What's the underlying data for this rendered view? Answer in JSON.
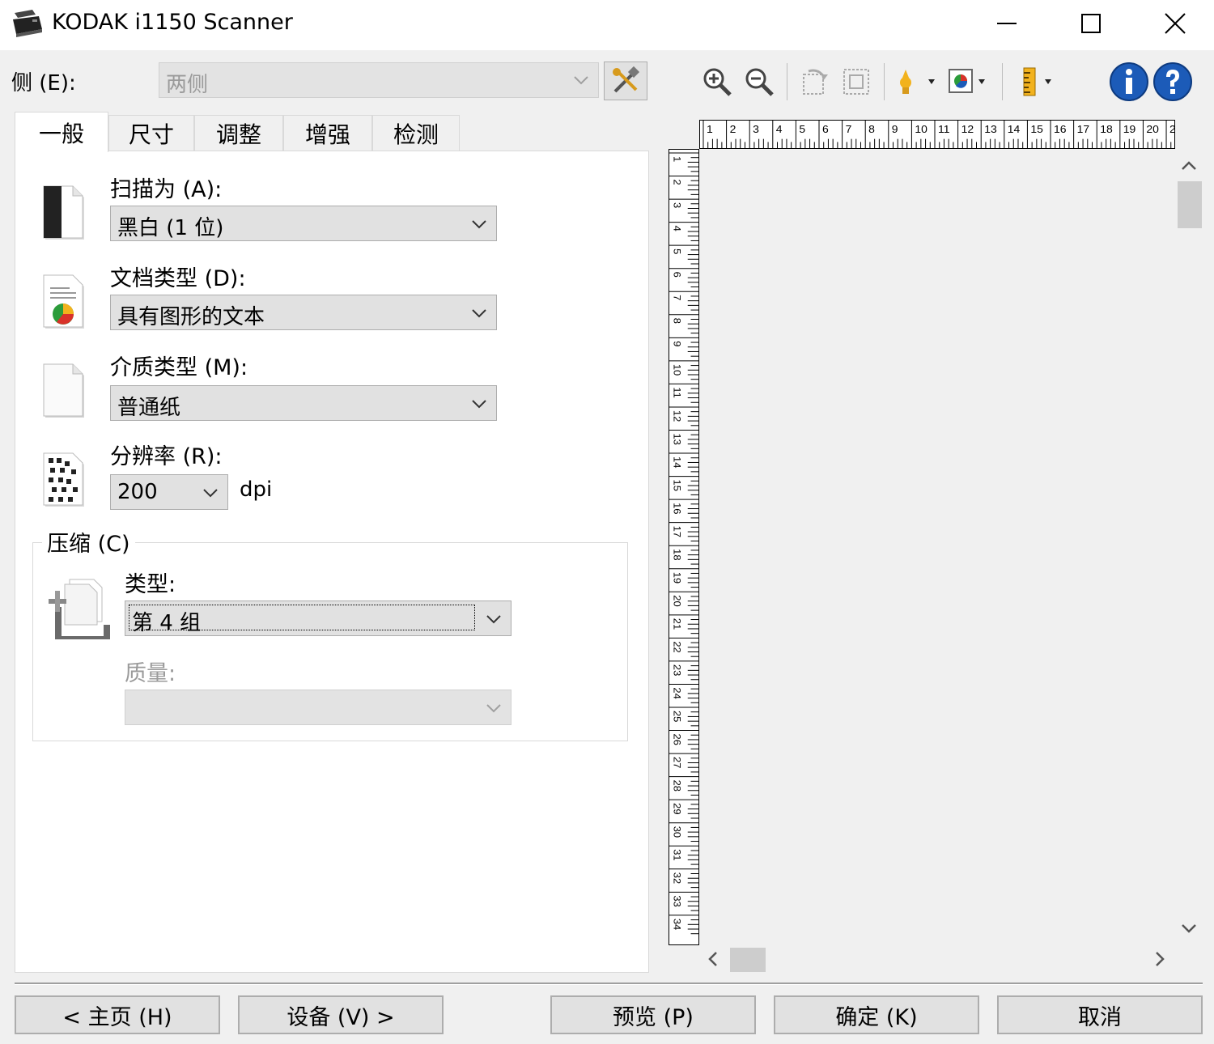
{
  "window": {
    "title": "KODAK i1150 Scanner",
    "minimize_icon": "minimize-icon",
    "maximize_icon": "maximize-icon",
    "close_icon": "close-icon"
  },
  "side": {
    "label": "侧 (E):",
    "value": "两侧"
  },
  "tabs": [
    {
      "label": "一般",
      "active": true
    },
    {
      "label": "尺寸"
    },
    {
      "label": "调整"
    },
    {
      "label": "增强"
    },
    {
      "label": "检测"
    }
  ],
  "general": {
    "scan_as": {
      "label": "扫描为 (A):",
      "value": "黑白 (1 位)"
    },
    "document_type": {
      "label": "文档类型 (D):",
      "value": "具有图形的文本"
    },
    "media_type": {
      "label": "介质类型 (M):",
      "value": "普通纸"
    },
    "resolution": {
      "label": "分辨率 (R):",
      "value": "200",
      "unit": "dpi"
    },
    "compression": {
      "title": "压缩 (C)",
      "type_label": "类型:",
      "type_value": "第 4 组",
      "quality_label": "质量:",
      "quality_value": ""
    }
  },
  "toolbar_icons": [
    "zoom-in-icon",
    "zoom-out-icon",
    "rotate-icon",
    "crop-outline-icon",
    "auto-adjust-icon",
    "color-icon",
    "ruler-icon",
    "info-icon",
    "help-icon"
  ],
  "ruler_top_ticks": [
    "1",
    "2",
    "3",
    "4",
    "5",
    "6",
    "7",
    "8",
    "9",
    "10",
    "11",
    "12",
    "13",
    "14",
    "15",
    "16",
    "17",
    "18",
    "19",
    "20",
    "2"
  ],
  "ruler_left_ticks": [
    "1",
    "2",
    "3",
    "4",
    "5",
    "6",
    "7",
    "8",
    "9",
    "10",
    "11",
    "12",
    "13",
    "14",
    "15",
    "16",
    "17",
    "18",
    "19",
    "20",
    "21",
    "22",
    "23",
    "24",
    "25",
    "26",
    "27",
    "28",
    "29",
    "30",
    "31",
    "32",
    "33",
    "34"
  ],
  "buttons": {
    "home": "< 主页 (H)",
    "device": "设备 (V) >",
    "preview": "预览 (P)",
    "ok": "确定 (K)",
    "cancel": "取消"
  },
  "colors": {
    "window_bg": "#f0f0f0",
    "info_blue": "#1c5bb8",
    "ruler_icon_yellow": "#f2b21d"
  }
}
